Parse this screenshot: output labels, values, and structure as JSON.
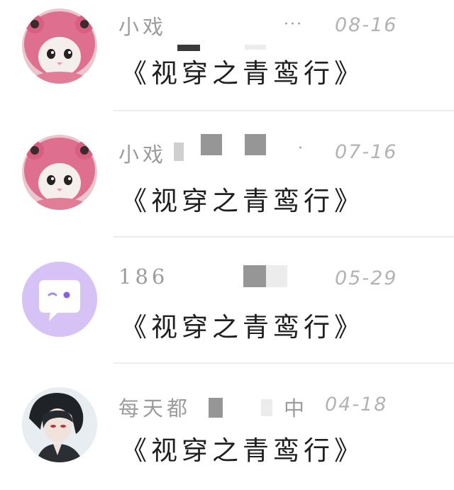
{
  "conversations": [
    {
      "name": "小戏",
      "extra": "···",
      "date": "08-16",
      "message": "《视穿之青鸾行》",
      "avatar": "pink-hat-cat-avatar"
    },
    {
      "name": "小戏",
      "extra": "·",
      "date": "07-16",
      "message": "《视穿之青鸾行》",
      "avatar": "pink-hat-cat-avatar"
    },
    {
      "name": "186",
      "extra": "",
      "date": "05-29",
      "message": "《视穿之青鸾行》",
      "avatar": "purple-chat-bubble-avatar"
    },
    {
      "name": "每天都",
      "extra": "中",
      "date": "04-18",
      "message": "《视穿之青鸾行》",
      "avatar": "anime-boy-avatar"
    }
  ],
  "colors": {
    "name": "#9c9c9c",
    "date": "#b3b3b3",
    "message": "#1f1f1f",
    "divider": "#ececec",
    "purple_avatar": "#d6c2f5"
  }
}
